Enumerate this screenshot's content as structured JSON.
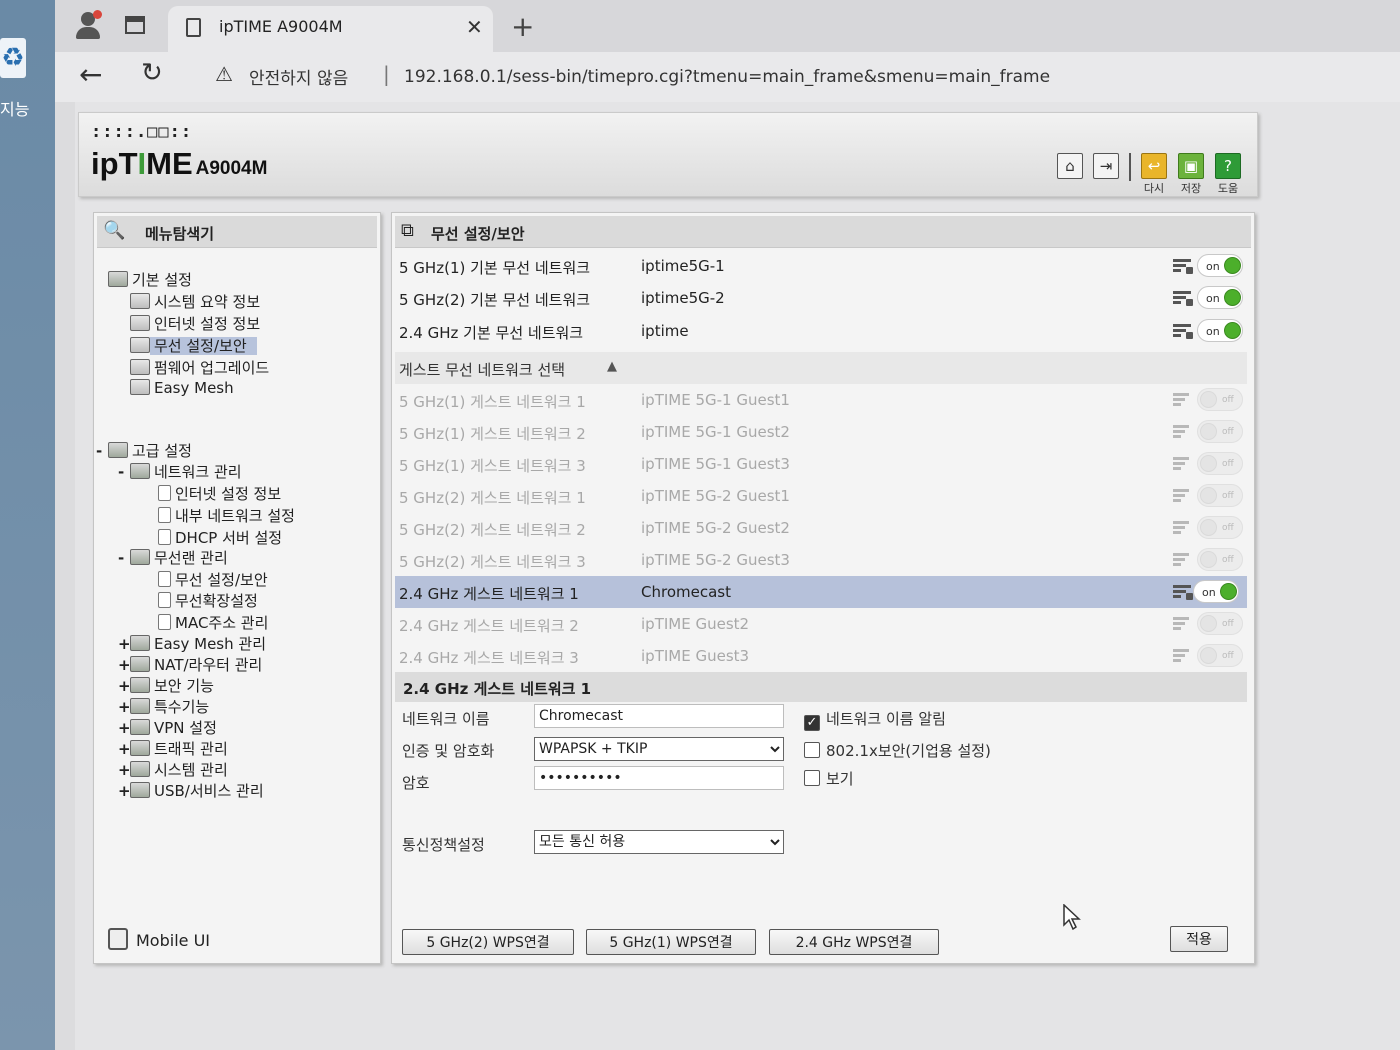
{
  "desktop": {
    "icon_label": "지능"
  },
  "browser": {
    "tab_title": "ipTIME A9004M",
    "security_text": "안전하지 않음",
    "url": "192.168.0.1/sess-bin/timepro.cgi?tmenu=main_frame&smenu=main_frame"
  },
  "header": {
    "logo_dots": "::::.□□::",
    "logo_ip": "ip",
    "logo_t": "T",
    "logo_i": "I",
    "logo_me": "ME",
    "model": "A9004M",
    "buttons": {
      "reload_label": "다시",
      "save_label": "저장",
      "help_label": "도움"
    }
  },
  "sidebar": {
    "title": "메뉴탐색기",
    "basic": {
      "label": "기본 설정",
      "items": [
        "시스템 요약 정보",
        "인터넷 설정 정보",
        "무선 설정/보안",
        "펌웨어 업그레이드",
        "Easy Mesh"
      ]
    },
    "advanced": {
      "toggle": "-",
      "label": "고급 설정",
      "network": {
        "toggle": "-",
        "label": "네트워크 관리",
        "items": [
          "인터넷 설정 정보",
          "내부 네트워크 설정",
          "DHCP 서버 설정"
        ]
      },
      "wireless": {
        "toggle": "-",
        "label": "무선랜 관리",
        "items": [
          "무선 설정/보안",
          "무선확장설정",
          "MAC주소 관리"
        ]
      },
      "others": [
        {
          "toggle": "+",
          "label": "Easy Mesh 관리"
        },
        {
          "toggle": "+",
          "label": "NAT/라우터 관리"
        },
        {
          "toggle": "+",
          "label": "보안 기능"
        },
        {
          "toggle": "+",
          "label": "특수기능"
        },
        {
          "toggle": "+",
          "label": "VPN 설정"
        },
        {
          "toggle": "+",
          "label": "트래픽 관리"
        },
        {
          "toggle": "+",
          "label": "시스템 관리"
        },
        {
          "toggle": "+",
          "label": "USB/서비스 관리"
        }
      ]
    },
    "mobile_ui": "Mobile UI"
  },
  "main": {
    "title": "무선 설정/보안",
    "networks": [
      {
        "name": "5 GHz(1) 기본 무선 네트워크",
        "ssid": "iptime5G-1",
        "state": "on"
      },
      {
        "name": "5 GHz(2) 기본 무선 네트워크",
        "ssid": "iptime5G-2",
        "state": "on"
      },
      {
        "name": "2.4 GHz 기본 무선 네트워크",
        "ssid": "iptime",
        "state": "on"
      }
    ],
    "guest_header": "게스트 무선 네트워크 선택",
    "guest_networks": [
      {
        "name": "5 GHz(1) 게스트 네트워크 1",
        "ssid": "ipTIME 5G-1 Guest1",
        "state": "off"
      },
      {
        "name": "5 GHz(1) 게스트 네트워크 2",
        "ssid": "ipTIME 5G-1 Guest2",
        "state": "off"
      },
      {
        "name": "5 GHz(1) 게스트 네트워크 3",
        "ssid": "ipTIME 5G-1 Guest3",
        "state": "off"
      },
      {
        "name": "5 GHz(2) 게스트 네트워크 1",
        "ssid": "ipTIME 5G-2 Guest1",
        "state": "off"
      },
      {
        "name": "5 GHz(2) 게스트 네트워크 2",
        "ssid": "ipTIME 5G-2 Guest2",
        "state": "off"
      },
      {
        "name": "5 GHz(2) 게스트 네트워크 3",
        "ssid": "ipTIME 5G-2 Guest3",
        "state": "off"
      },
      {
        "name": "2.4 GHz 게스트 네트워크 1",
        "ssid": "Chromecast",
        "state": "on"
      },
      {
        "name": "2.4 GHz 게스트 네트워크 2",
        "ssid": "ipTIME Guest2",
        "state": "off"
      },
      {
        "name": "2.4 GHz 게스트 네트워크 3",
        "ssid": "ipTIME Guest3",
        "state": "off"
      }
    ],
    "selected_section_title": "2.4 GHz 게스트 네트워크 1",
    "form": {
      "network_name_label": "네트워크 이름",
      "network_name_value": "Chromecast",
      "auth_label": "인증 및 암호화",
      "auth_value": "WPAPSK + TKIP",
      "password_label": "암호",
      "password_value": "••••••••••",
      "broadcast_label": "네트워크 이름 알림",
      "dot1x_label": "802.1x보안(기업용 설정)",
      "show_label": "보기",
      "policy_label": "통신정책설정",
      "policy_value": "모든 통신 허용"
    },
    "buttons": {
      "wps_5g2": "5 GHz(2) WPS연결",
      "wps_5g1": "5 GHz(1) WPS연결",
      "wps_24": "2.4 GHz WPS연결",
      "apply": "적용"
    }
  }
}
